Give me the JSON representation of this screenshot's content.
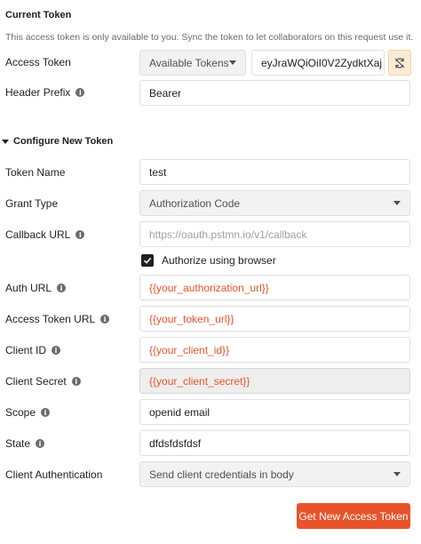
{
  "current_token": {
    "title": "Current Token",
    "description": "This access token is only available to you. Sync the token to let collaborators on this request use it.",
    "access_token_label": "Access Token",
    "available_tokens_label": "Available Tokens",
    "token_value": "eyJraWQiOiI0V2ZydktXaj ...",
    "header_prefix_label": "Header Prefix",
    "header_prefix_value": "Bearer"
  },
  "configure": {
    "title": "Configure New Token",
    "token_name_label": "Token Name",
    "token_name_value": "test",
    "grant_type_label": "Grant Type",
    "grant_type_value": "Authorization Code",
    "callback_url_label": "Callback URL",
    "callback_url_placeholder": "https://oauth.pstmn.io/v1/callback",
    "authorize_browser_label": "Authorize using browser",
    "auth_url_label": "Auth URL",
    "auth_url_value": "{{your_authorization_url}}",
    "access_token_url_label": "Access Token URL",
    "access_token_url_value": "{{your_token_url}}",
    "client_id_label": "Client ID",
    "client_id_value": "{{your_client_id}}",
    "client_secret_label": "Client Secret",
    "client_secret_value": "{{your_client_secret}}",
    "scope_label": "Scope",
    "scope_value": "openid email",
    "state_label": "State",
    "state_value": "dfdsfdsfdsf",
    "client_auth_label": "Client Authentication",
    "client_auth_value": "Send client credentials in body",
    "get_token_button": "Get New Access Token"
  },
  "colors": {
    "accent": "#e8542a",
    "variable_text": "#e8542a",
    "sync_button_bg": "#fdebd3"
  },
  "icons": {
    "info": "info-icon",
    "sync": "sync-icon",
    "caret": "chevron-down-icon",
    "section_toggle": "caret-down-icon",
    "checkbox": "checkmark-icon"
  }
}
